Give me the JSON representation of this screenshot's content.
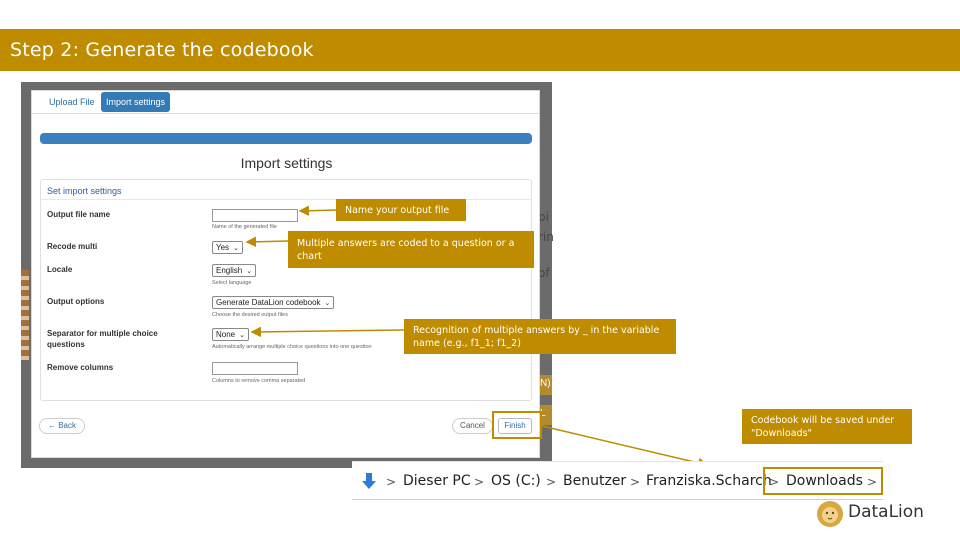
{
  "slide": {
    "title": "Step 2: Generate the codebook",
    "accent_color": "#bf8c00"
  },
  "background_fragments": [
    "pi",
    "rin",
    "of",
    "N)",
    "L"
  ],
  "dialog": {
    "tabs": [
      {
        "label": "Upload File",
        "active": false
      },
      {
        "label": "Import settings",
        "active": true
      }
    ],
    "progress": 1.0,
    "title": "Import settings",
    "panel_heading": "Set import settings",
    "fields": [
      {
        "label": "Output file name",
        "type": "text",
        "value": "",
        "help": "Name of the generated file"
      },
      {
        "label": "Recode multi",
        "type": "select",
        "value": "Yes",
        "help": ""
      },
      {
        "label": "Locale",
        "type": "select",
        "value": "English",
        "help": "Select language"
      },
      {
        "label": "Output options",
        "type": "select",
        "value": "Generate DataLion codebook",
        "help": "Choose the desired output files"
      },
      {
        "label": "Separator for multiple choice questions",
        "type": "select",
        "value": "None",
        "help": "Automatically arrange multiple choice questions into one question"
      },
      {
        "label": "Remove columns",
        "type": "text",
        "value": "",
        "help": "Columns to remove comma separated"
      }
    ],
    "buttons": {
      "back": "← Back",
      "cancel": "Cancel",
      "finish": "Finish"
    }
  },
  "callouts": [
    "Name your output file",
    "Multiple answers are coded to a question or a chart",
    "Recognition of multiple answers by _ in the variable name (e.g., f1_1; f1_2)",
    "Codebook will be saved under \"Downloads\""
  ],
  "explorer": {
    "icon": "down-arrow-icon",
    "path": [
      "Dieser PC",
      "OS (C:)",
      "Benutzer",
      "Franziska.Scharch",
      "Downloads"
    ],
    "separator": ">"
  },
  "logo": {
    "icon": "lion-icon",
    "text": "DataLion"
  }
}
